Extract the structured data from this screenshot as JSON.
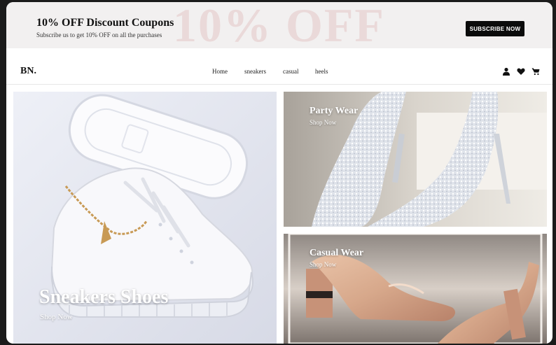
{
  "promo": {
    "watermark": "10% OFF",
    "title": "10% OFF Discount Coupons",
    "subtitle": "Subscribe us to get 10% OFF on all the purchases",
    "button_label": "SUBSCRIBE NOW"
  },
  "nav": {
    "logo": "BN.",
    "links": [
      "Home",
      "sneakers",
      "casual",
      "heels"
    ],
    "icons": [
      "user-icon",
      "heart-icon",
      "cart-icon"
    ]
  },
  "hero": {
    "tiles": [
      {
        "title": "Sneakers Shoes",
        "link": "Shop Now"
      },
      {
        "title": "Party Wear",
        "link": "Shop Now"
      },
      {
        "title": "Casual Wear",
        "link": "Shop Now"
      }
    ]
  },
  "colors": {
    "promo_bg": "#f2f0f0",
    "watermark": "#ead9d9",
    "button_bg": "#0b0b0b",
    "page_bg": "#ffffff",
    "outer_bg": "#1b1b1b"
  }
}
